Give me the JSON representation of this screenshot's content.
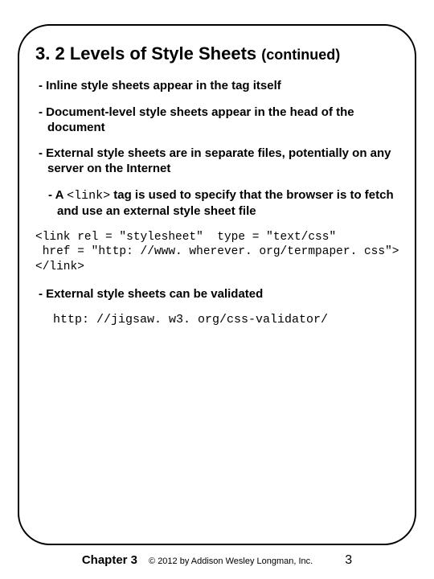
{
  "heading": {
    "number": "3. 2",
    "title": "Levels of Style Sheets",
    "continued": "(continued)"
  },
  "bullets": {
    "b1": "- Inline style sheets appear in the tag itself",
    "b2": "- Document-level style sheets appear in the head of the document",
    "b3": "- External style sheets are in separate files, potentially on any server on the Internet",
    "b4_pre": "- A ",
    "b4_code": "<link>",
    "b4_post": " tag is used to specify that the browser is to fetch and use an external style sheet file",
    "b5": "- External style sheets can be validated"
  },
  "code": {
    "line1": "<link rel = \"stylesheet\"  type = \"text/css\"",
    "line2": " href = \"http: //www. wherever. org/termpaper. css\">",
    "line3": "</link>"
  },
  "validator_url": "http: //jigsaw. w3. org/css-validator/",
  "footer": {
    "chapter": "Chapter 3",
    "copyright": "© 2012 by Addison Wesley Longman, Inc.",
    "page": "3"
  }
}
